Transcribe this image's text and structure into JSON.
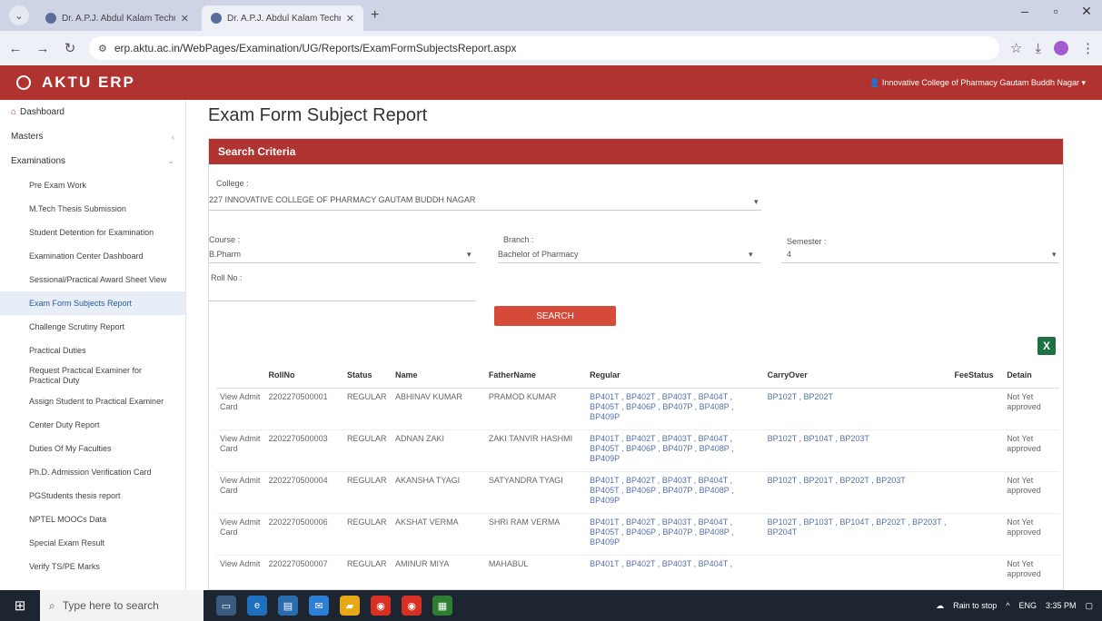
{
  "browser": {
    "tabs": [
      {
        "label": "Dr. A.P.J. Abdul Kalam Techn",
        "active": false
      },
      {
        "label": "Dr. A.P.J. Abdul Kalam Techno",
        "active": true
      }
    ],
    "url": "erp.aktu.ac.in/WebPages/Examination/UG/Reports/ExamFormSubjectsReport.aspx"
  },
  "app": {
    "brand": "AKTU ERP",
    "institution": "Innovative College of Pharmacy Gautam Buddh Nagar"
  },
  "sidebar": {
    "top": [
      {
        "label": "Dashboard"
      },
      {
        "label": "Masters"
      },
      {
        "label": "Examinations"
      }
    ],
    "sub": [
      {
        "label": "Pre Exam Work"
      },
      {
        "label": "M.Tech Thesis Submission"
      },
      {
        "label": "Student Detention for Examination"
      },
      {
        "label": "Examination Center Dashboard"
      },
      {
        "label": "Sessional/Practical Award Sheet View"
      },
      {
        "label": "Exam Form Subjects Report",
        "active": true
      },
      {
        "label": "Challenge Scrutiny Report"
      },
      {
        "label": "Practical Duties"
      },
      {
        "label": "Request Practical Examiner for Practical Duty"
      },
      {
        "label": "Assign Student to Practical Examiner"
      },
      {
        "label": "Center Duty Report"
      },
      {
        "label": "Duties Of My Faculties"
      },
      {
        "label": "Ph.D. Admission Verification Card"
      },
      {
        "label": "PGStudents thesis report"
      },
      {
        "label": "NPTEL MOOCs Data"
      },
      {
        "label": "Special Exam Result"
      },
      {
        "label": "Verify TS/PE Marks"
      }
    ]
  },
  "page": {
    "title": "Exam Form Subject Report",
    "panel_title": "Search Criteria",
    "college_label": "College :",
    "college_value": "227 INNOVATIVE COLLEGE OF PHARMACY GAUTAM BUDDH NAGAR",
    "course_label": "Course :",
    "course_value": "B.Pharm",
    "branch_label": "Branch :",
    "branch_value": "Bachelor of Pharmacy",
    "semester_label": "Semester :",
    "semester_value": "4",
    "rollno_label": "Roll No :",
    "search_button": "SEARCH",
    "excel_icon_label": "X"
  },
  "table": {
    "headers": [
      "",
      "RollNo",
      "Status",
      "Name",
      "FatherName",
      "Regular",
      "CarryOver",
      "FeeStatus",
      "Detain"
    ],
    "rows": [
      {
        "action": "View Admit Card",
        "roll": "2202270500001",
        "status": "REGULAR",
        "name": "ABHINAV KUMAR",
        "father": "PRAMOD KUMAR",
        "regular": "BP401T , BP402T , BP403T , BP404T , BP405T , BP406P , BP407P , BP408P , BP409P",
        "carry": "BP102T , BP202T",
        "fee": "",
        "detain": "Not Yet approved"
      },
      {
        "action": "View Admit Card",
        "roll": "2202270500003",
        "status": "REGULAR",
        "name": "ADNAN ZAKI",
        "father": "ZAKI TANVIR HASHMI",
        "regular": "BP401T , BP402T , BP403T , BP404T , BP405T , BP406P , BP407P , BP408P , BP409P",
        "carry": "BP102T , BP104T , BP203T",
        "fee": "",
        "detain": "Not Yet approved"
      },
      {
        "action": "View Admit Card",
        "roll": "2202270500004",
        "status": "REGULAR",
        "name": "AKANSHA TYAGI",
        "father": "SATYANDRA TYAGI",
        "regular": "BP401T , BP402T , BP403T , BP404T , BP405T , BP406P , BP407P , BP408P , BP409P",
        "carry": "BP102T , BP201T , BP202T , BP203T",
        "fee": "",
        "detain": "Not Yet approved"
      },
      {
        "action": "View Admit Card",
        "roll": "2202270500006",
        "status": "REGULAR",
        "name": "AKSHAT VERMA",
        "father": "SHRI RAM VERMA",
        "regular": "BP401T , BP402T , BP403T , BP404T , BP405T , BP406P , BP407P , BP408P , BP409P",
        "carry": "BP102T , BP103T , BP104T , BP202T , BP203T , BP204T",
        "fee": "",
        "detain": "Not Yet approved"
      },
      {
        "action": "View Admit",
        "roll": "2202270500007",
        "status": "REGULAR",
        "name": "AMINUR MIYA",
        "father": "MAHABUL",
        "regular": "BP401T , BP402T , BP403T , BP404T ,",
        "carry": "",
        "fee": "",
        "detain": "Not Yet approved"
      }
    ]
  },
  "taskbar": {
    "search_placeholder": "Type here to search",
    "weather": "Rain to stop",
    "lang": "ENG",
    "time": "3:35 PM"
  }
}
